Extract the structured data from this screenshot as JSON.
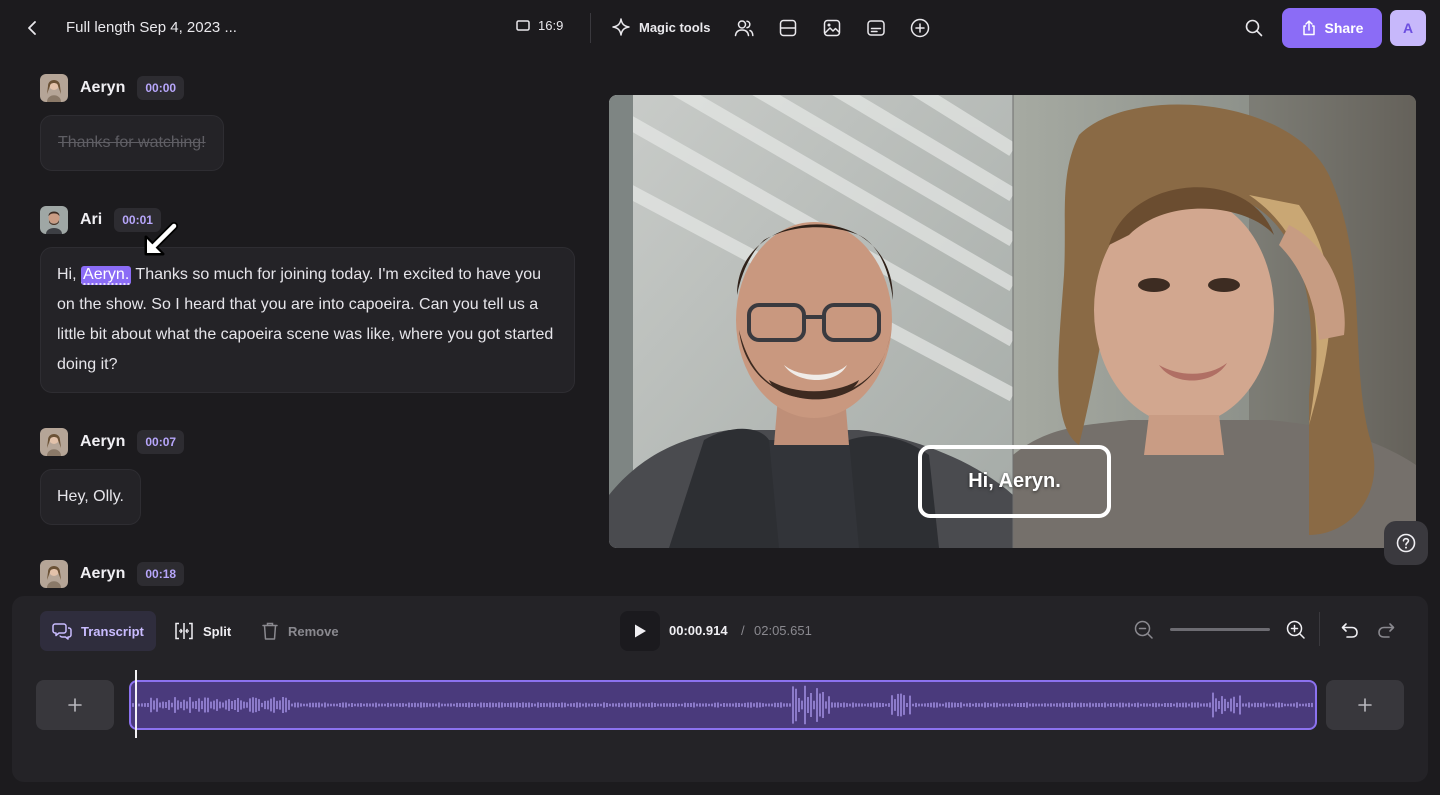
{
  "header": {
    "title": "Full length Sep 4, 2023 ...",
    "aspect_ratio": "16:9",
    "magic_tools_label": "Magic tools",
    "share_label": "Share",
    "user_initial": "A"
  },
  "transcript": [
    {
      "speaker": "Aeryn",
      "time": "00:00",
      "text": "Thanks for watching!",
      "struck": true
    },
    {
      "speaker": "Ari",
      "time": "00:01",
      "text_before": "Hi,",
      "highlight": "Aeryn.",
      "text_after": "Thanks so much for joining today. I'm excited to have you on the show. So I heard that you are into capoeira. Can you tell us a little bit about what the capoeira scene was like, where you got started doing it?"
    },
    {
      "speaker": "Aeryn",
      "time": "00:07",
      "text": "Hey, Olly."
    },
    {
      "speaker": "Aeryn",
      "time": "00:18"
    }
  ],
  "video": {
    "caption": "Hi, Aeryn."
  },
  "timeline": {
    "transcript_label": "Transcript",
    "split_label": "Split",
    "remove_label": "Remove",
    "current_time": "00:00.914",
    "separator": "/",
    "duration": "02:05.651",
    "playhead_fraction": 0.0073
  },
  "colors": {
    "accent": "#8b6cf6",
    "background": "#1c1b1e",
    "panel": "#242327",
    "track": "#4a3a7c"
  }
}
